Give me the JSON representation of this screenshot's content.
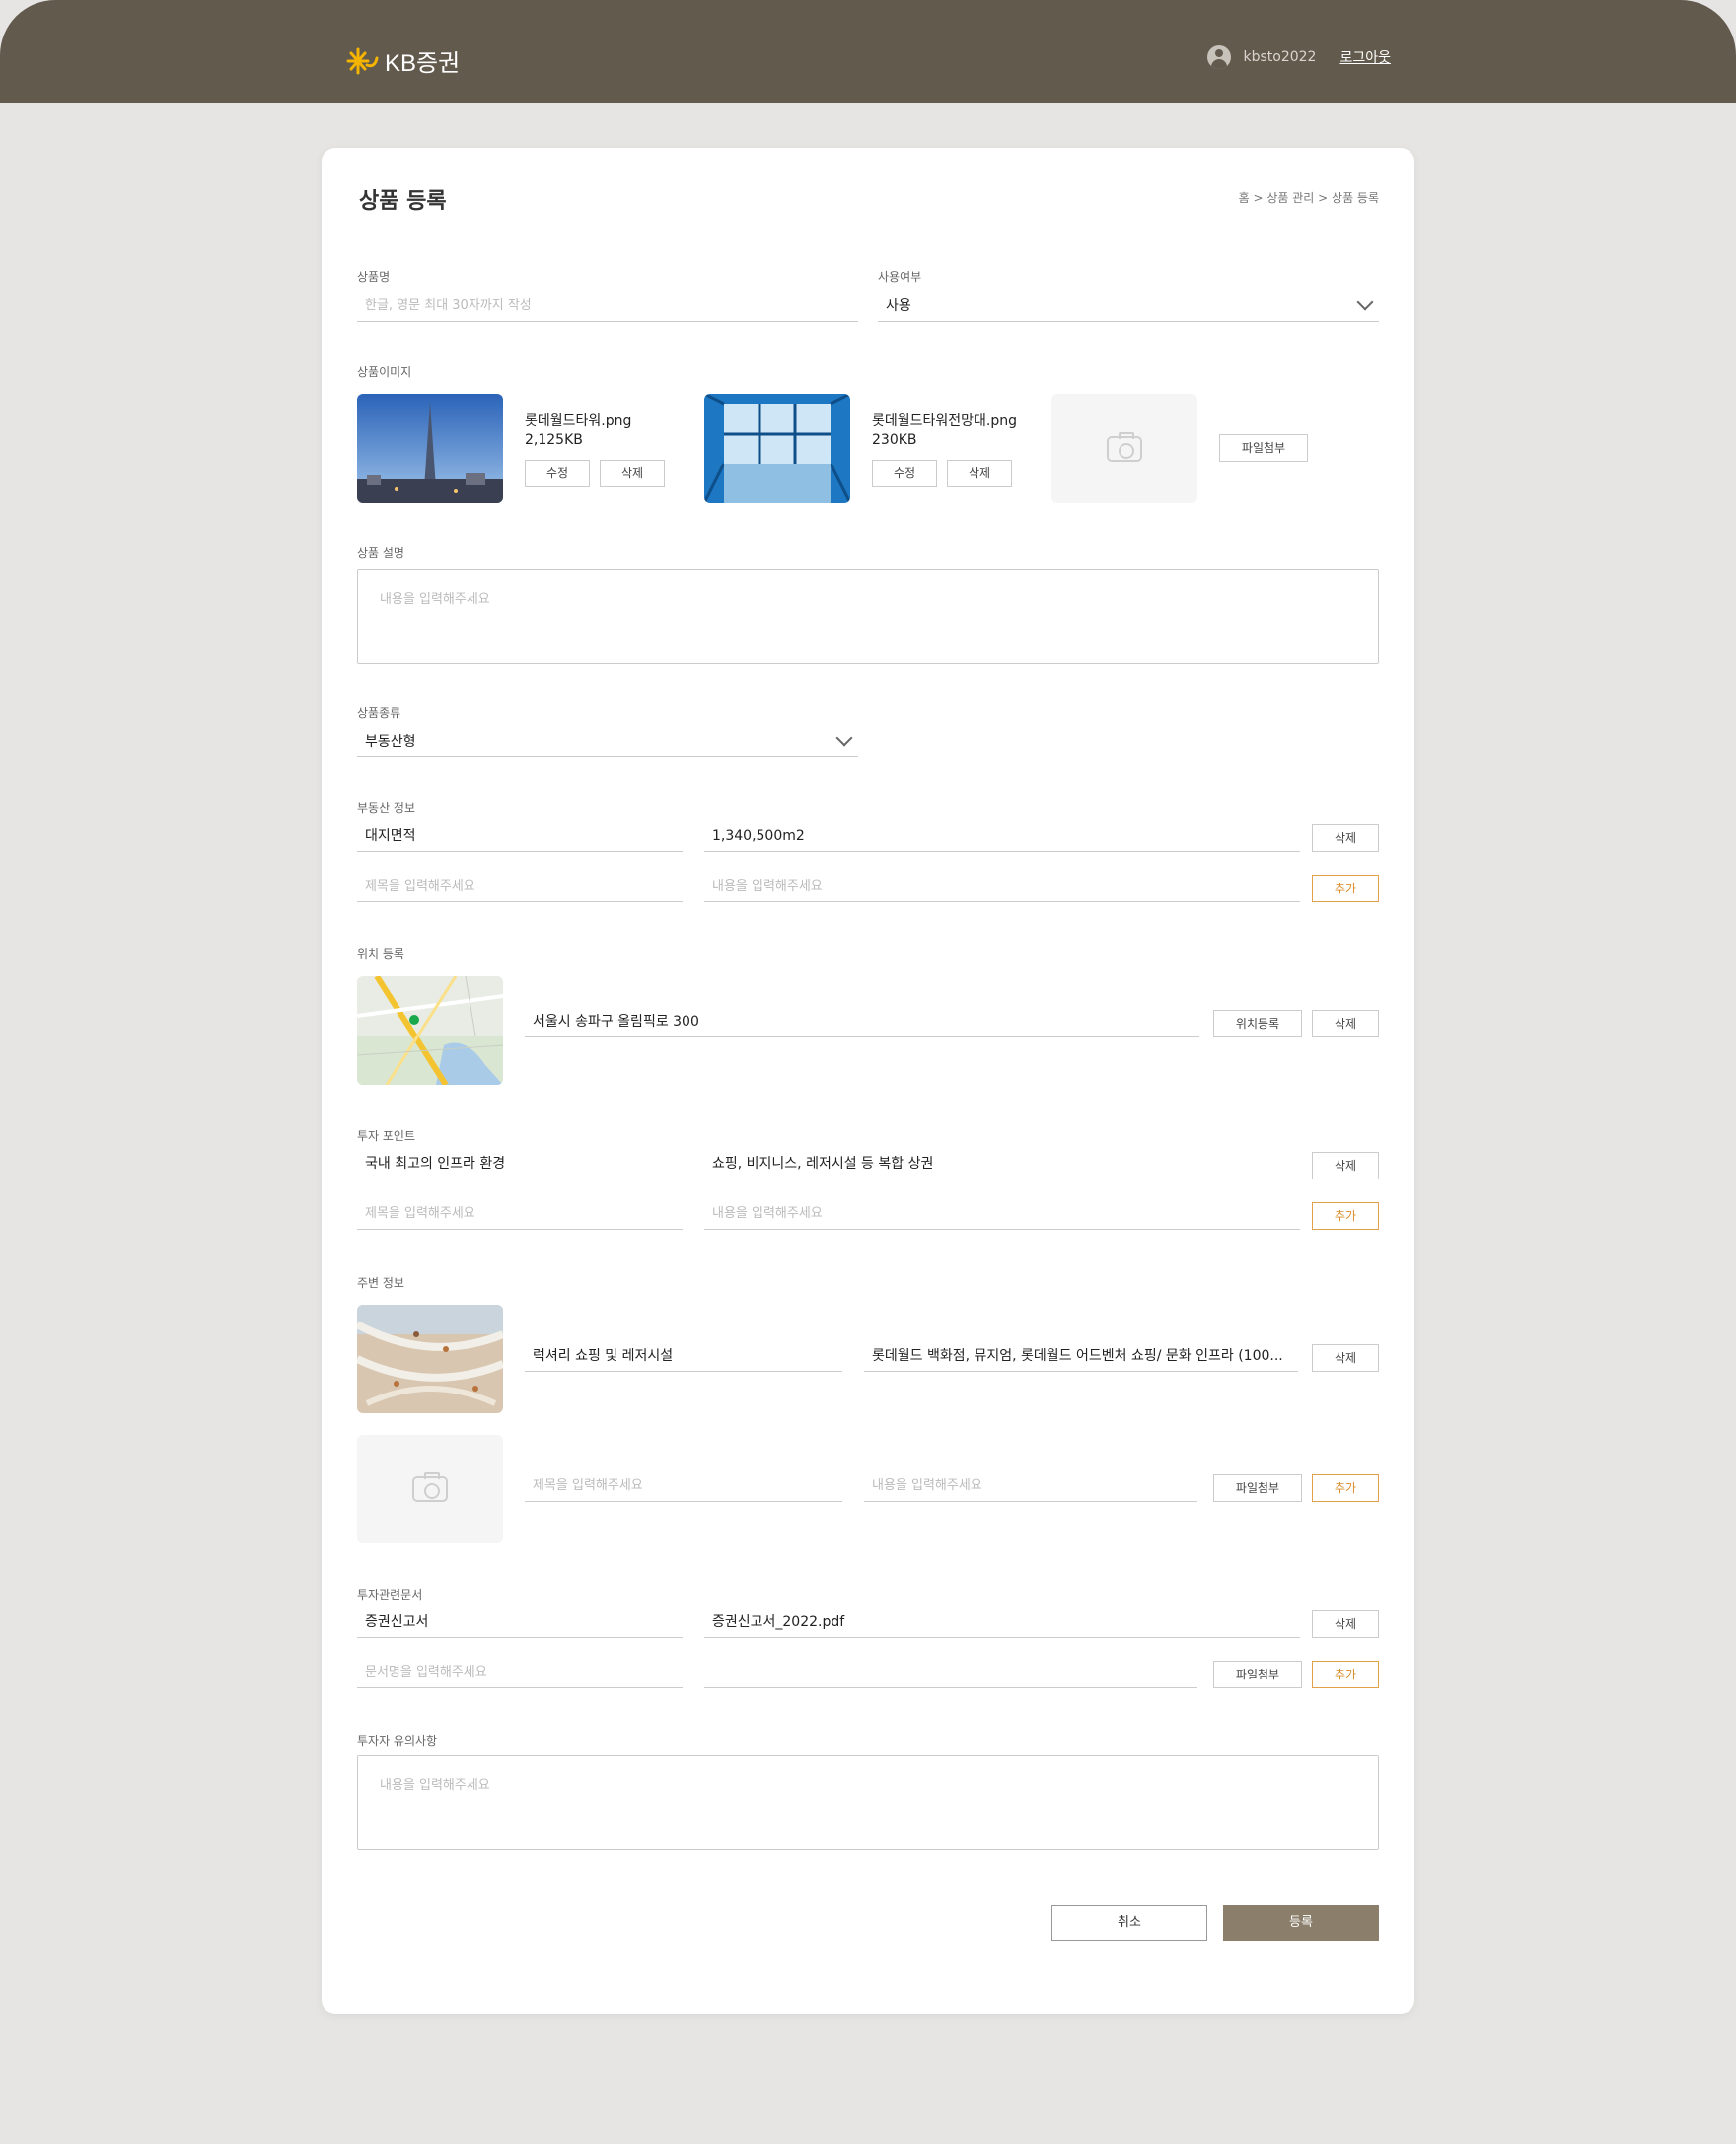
{
  "header": {
    "logo_text": "KB증권",
    "username": "kbsto2022",
    "logout_label": "로그아웃"
  },
  "page": {
    "title": "상품 등록",
    "breadcrumb": "홈 > 상품 관리 > 상품 등록"
  },
  "product_name": {
    "label": "상품명",
    "placeholder": "한글, 영문 최대 30자까지 작성"
  },
  "usage": {
    "label": "사용여부",
    "value": "사용"
  },
  "images": {
    "label": "상품이미지",
    "items": [
      {
        "name": "롯데월드타워.png",
        "size": "2,125KB",
        "edit_label": "수정",
        "delete_label": "삭제"
      },
      {
        "name": "롯데월드타워전망대.png",
        "size": "230KB",
        "edit_label": "수정",
        "delete_label": "삭제"
      }
    ],
    "attach_label": "파일첨부"
  },
  "description": {
    "label": "상품 설명",
    "placeholder": "내용을 입력해주세요"
  },
  "product_type": {
    "label": "상품종류",
    "value": "부동산형"
  },
  "realestate": {
    "label": "부동산 정보",
    "rows": [
      {
        "title": "대지면적",
        "content": "1,340,500m2",
        "action": "삭제"
      }
    ],
    "new_title_placeholder": "제목을 입력해주세요",
    "new_content_placeholder": "내용을 입력해주세요",
    "add_label": "추가"
  },
  "location": {
    "label": "위치 등록",
    "address": "서울시 송파구 올림픽로 300",
    "register_label": "위치등록",
    "delete_label": "삭제"
  },
  "invest_point": {
    "label": "투자 포인트",
    "rows": [
      {
        "title": "국내 최고의 인프라 환경",
        "content": "쇼핑, 비지니스, 레저시설 등 복합 상권",
        "action": "삭제"
      }
    ],
    "new_title_placeholder": "제목을 입력해주세요",
    "new_content_placeholder": "내용을 입력해주세요",
    "add_label": "추가"
  },
  "nearby": {
    "label": "주변 정보",
    "rows": [
      {
        "title": "럭셔리  쇼핑 및 레저시설",
        "content": "롯데월드 백화점, 뮤지엄, 롯데월드 어드벤처 쇼핑/ 문화 인프라 (100...",
        "action": "삭제"
      }
    ],
    "new_title_placeholder": "제목을 입력해주세요",
    "new_content_placeholder": "내용을 입력해주세요",
    "attach_label": "파일첨부",
    "add_label": "추가"
  },
  "documents": {
    "label": "투자관련문서",
    "rows": [
      {
        "title": "증권신고서",
        "file": "증권신고서_2022.pdf",
        "action": "삭제"
      }
    ],
    "new_title_placeholder": "문서명을 입력해주세요",
    "attach_label": "파일첨부",
    "add_label": "추가"
  },
  "notice": {
    "label": "투자자 유의사항",
    "placeholder": "내용을 입력해주세요"
  },
  "footer": {
    "cancel_label": "취소",
    "submit_label": "등록"
  },
  "colors": {
    "header_bg": "#625a4d",
    "accent": "#d98d2a",
    "submit_bg": "#8b7e6b",
    "logo_star": "#f5b400"
  }
}
